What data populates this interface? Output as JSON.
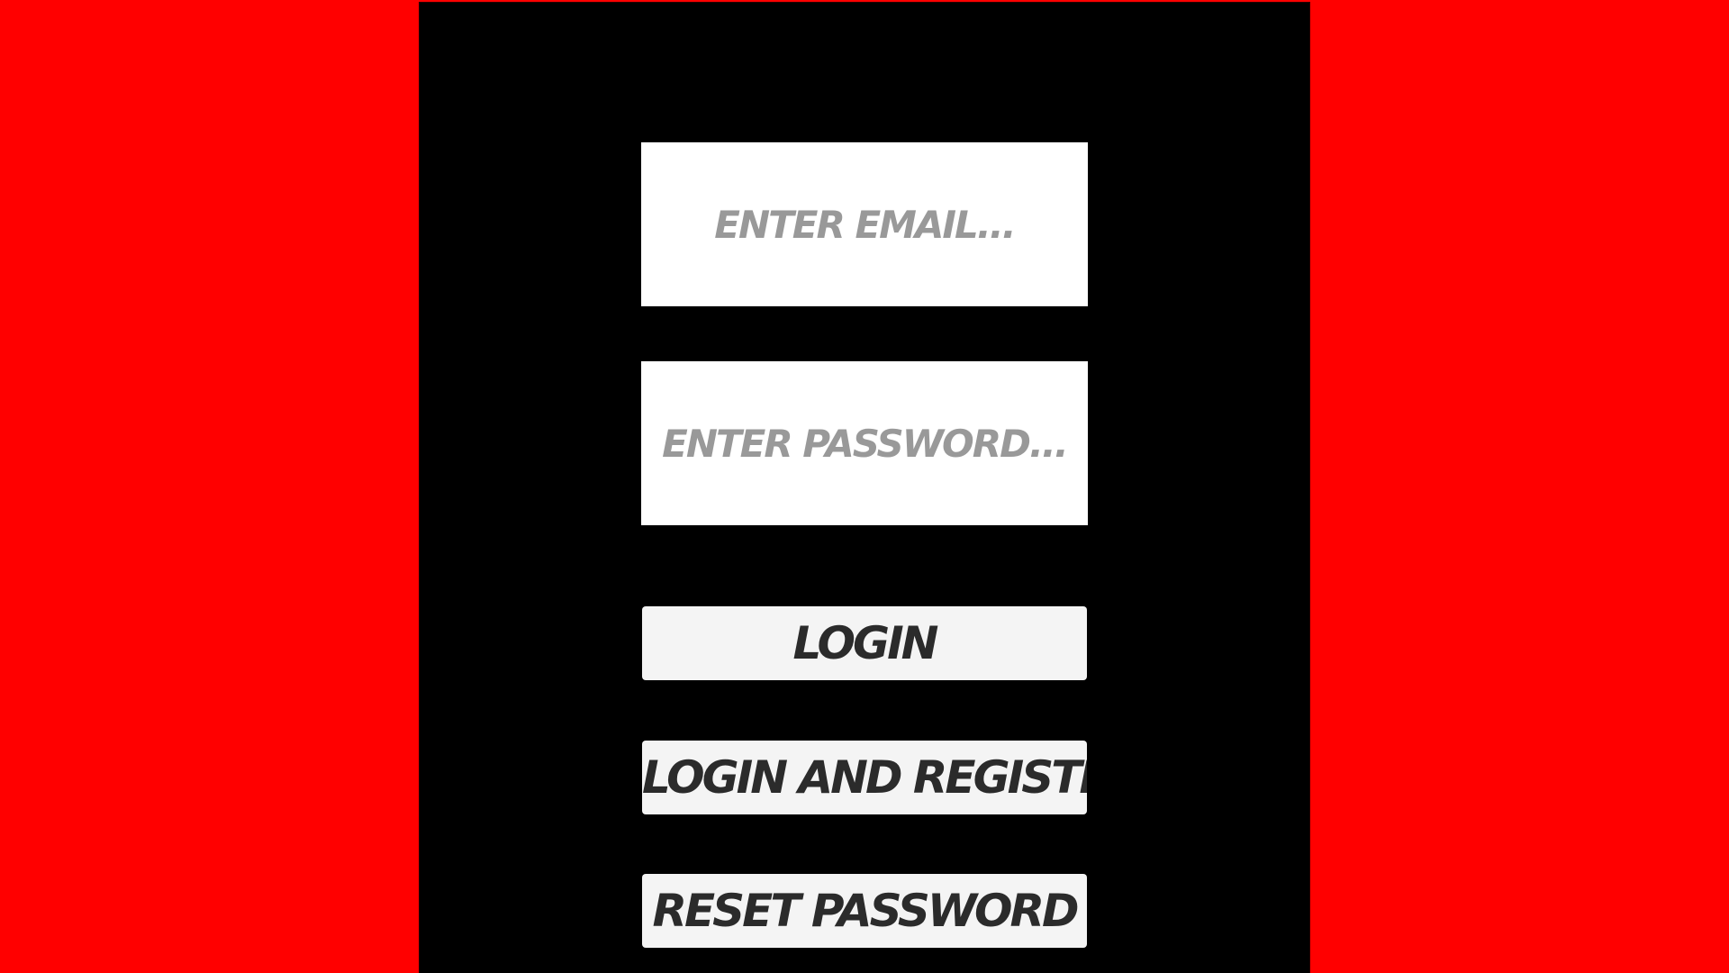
{
  "form": {
    "email": {
      "value": "",
      "placeholder": "ENTER EMAIL..."
    },
    "password": {
      "value": "",
      "placeholder": "ENTER PASSWORD..."
    }
  },
  "buttons": {
    "login_label": "LOGIN",
    "login_register_label": "LOGIN AND REGISTER",
    "reset_password_label": "RESET PASSWORD"
  },
  "colors": {
    "page_background": "#ff0000",
    "panel_background": "#000000",
    "field_background": "#ffffff",
    "placeholder_text": "#999999",
    "button_background": "#f4f4f4",
    "button_text": "#2b2b2b"
  }
}
